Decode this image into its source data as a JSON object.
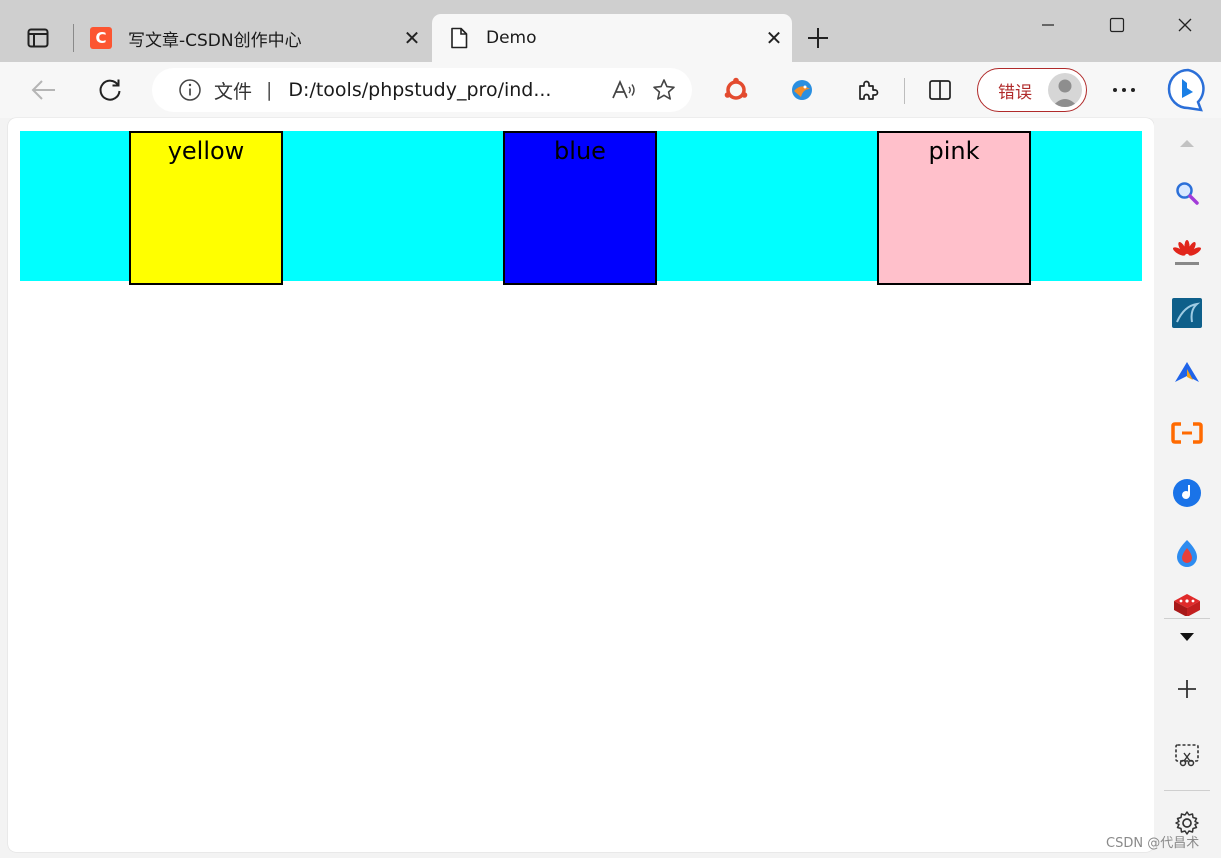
{
  "tabs": [
    {
      "title": "写文章-CSDN创作中心",
      "favicon": "csdn-logo",
      "favicon_letter": "C",
      "active": false
    },
    {
      "title": "Demo",
      "favicon": "page-icon",
      "active": true
    }
  ],
  "window_controls": {
    "minimize": "minimize-icon",
    "maximize": "maximize-icon",
    "close": "close-icon"
  },
  "address_bar": {
    "info_icon": "info-icon",
    "label": "文件",
    "separator": "|",
    "url": "D:/tools/phpstudy_pro/ind..."
  },
  "profile": {
    "status_label": "错误",
    "status_color": "#b02a2a"
  },
  "page": {
    "container_color": "#00ffff",
    "boxes": [
      {
        "label": "yellow",
        "color": "#ffff00"
      },
      {
        "label": "blue",
        "color": "#0000ff"
      },
      {
        "label": "pink",
        "color": "#ffc0cb"
      }
    ]
  },
  "sidebar": {
    "items": [
      "search-icon",
      "huawei-icon",
      "mysql-icon",
      "app-icon",
      "alibaba-cloud-icon",
      "music-icon",
      "browser-icon",
      "game-icon"
    ]
  },
  "watermark": "CSDN @代昌术"
}
